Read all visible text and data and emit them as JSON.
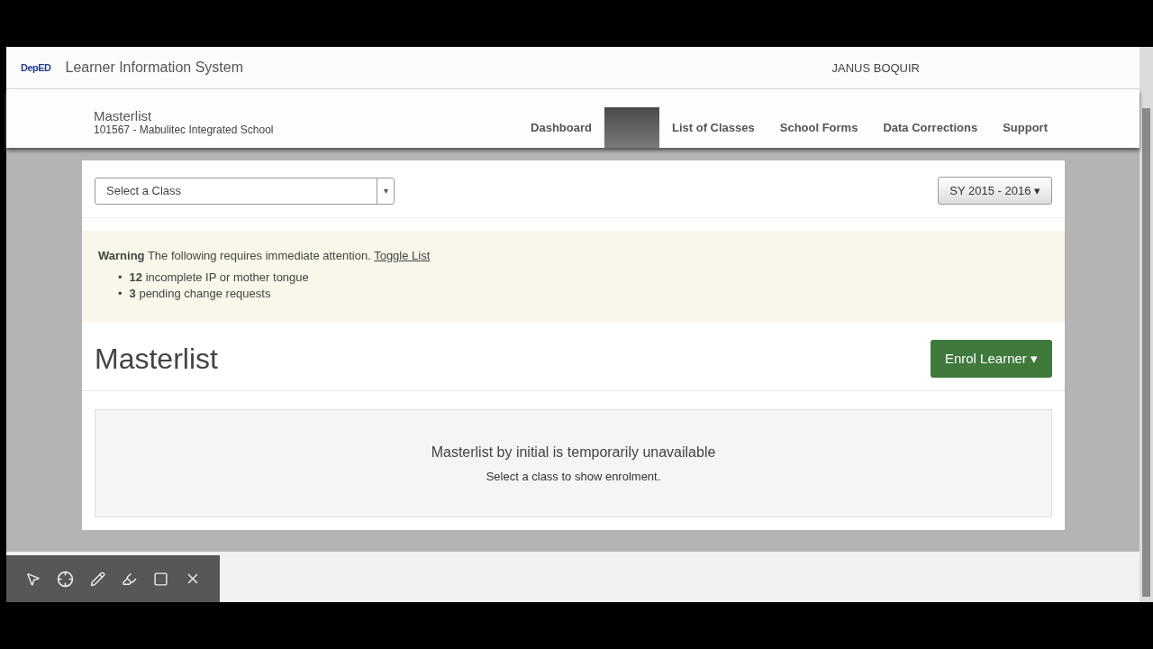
{
  "header": {
    "logo": "DepED",
    "title": "Learner Information System",
    "user": "JANUS BOQUIR"
  },
  "page": {
    "title": "Masterlist",
    "subtitle": "101567 - Mabulitec Integrated School"
  },
  "nav": [
    {
      "label": "Dashboard",
      "selected": false
    },
    {
      "selected": true
    },
    {
      "label": "List of Classes",
      "selected": false
    },
    {
      "label": "School Forms",
      "selected": false
    },
    {
      "label": "Data Corrections",
      "selected": false
    },
    {
      "label": "Support",
      "selected": false
    }
  ],
  "class_select": {
    "placeholder": "Select a Class",
    "caret": "▾"
  },
  "year_button": {
    "label": "SY 2015 - 2016",
    "caret": "▾"
  },
  "warning": {
    "lead": "Warning",
    "text": "The following requires immediate attention.",
    "link": "Toggle List",
    "bullet": "•",
    "items": [
      "**12** incomplete IP or mother tongue",
      "**3** pending change requests"
    ]
  },
  "heading": "Masterlist",
  "enrol_button": {
    "label": "Enrol Learner",
    "caret": "▾"
  },
  "notice": {
    "title": "Masterlist by initial is temporarily unavailable",
    "text": "Select a class to show enrolment."
  }
}
